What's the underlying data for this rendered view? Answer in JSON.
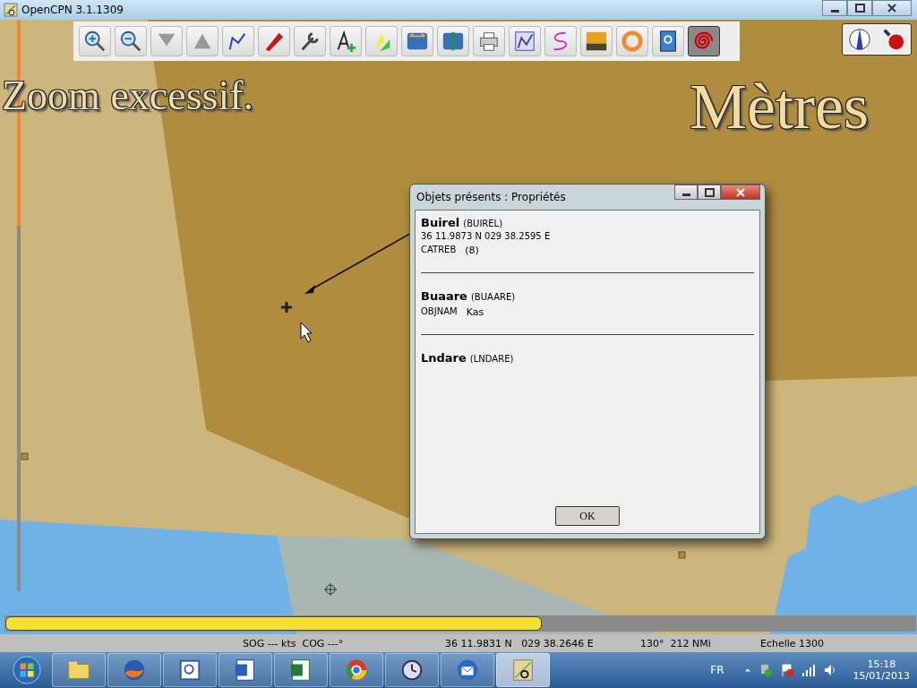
{
  "window": {
    "title": "OpenCPN 3.1.1309"
  },
  "toolbar": [
    {
      "kind": "zoom-in",
      "selected": false
    },
    {
      "kind": "zoom-out",
      "selected": false
    },
    {
      "kind": "funnel",
      "selected": false
    },
    {
      "kind": "cone",
      "selected": false
    },
    {
      "kind": "route",
      "selected": false
    },
    {
      "kind": "boat",
      "selected": false
    },
    {
      "kind": "wrench",
      "selected": false
    },
    {
      "kind": "text-add",
      "selected": false
    },
    {
      "kind": "flags",
      "selected": false
    },
    {
      "kind": "width",
      "selected": false
    },
    {
      "kind": "height",
      "selected": false
    },
    {
      "kind": "printer",
      "selected": false
    },
    {
      "kind": "chart-edit",
      "selected": false
    },
    {
      "kind": "track",
      "selected": false
    },
    {
      "kind": "sunset",
      "selected": false
    },
    {
      "kind": "ring",
      "selected": false
    },
    {
      "kind": "help-book",
      "selected": false
    },
    {
      "kind": "spiral",
      "selected": true
    }
  ],
  "map": {
    "zoom_warning": "Zoom excessif.",
    "units_label": "Mètres",
    "quilt_bar": {
      "level": 0.59
    }
  },
  "dialog": {
    "title": "Objets présents : Propriétés",
    "objects": [
      {
        "name": "Buirel",
        "code": "(BUIREL)",
        "position": "36 11.9873 N 029 38.2595 E",
        "attributes": [
          {
            "label": "CATREB",
            "value": "(8)"
          }
        ]
      },
      {
        "name": "Buaare",
        "code": "(BUAARE)",
        "attributes": [
          {
            "label": "OBJNAM",
            "value": "Kas"
          }
        ]
      },
      {
        "name": "Lndare",
        "code": "(LNDARE)"
      }
    ],
    "ok_button": "OK"
  },
  "status_bar": [
    "SOG --- kts  COG ---°",
    "36 11.9831 N   029 38.2646 E",
    "130°  212 NMi",
    "Echelle 1300"
  ],
  "taskbar": {
    "apps": [
      {
        "kind": "folder",
        "selected": false
      },
      {
        "kind": "globe",
        "selected": false
      },
      {
        "kind": "presentation",
        "selected": false
      },
      {
        "kind": "document",
        "selected": false
      },
      {
        "kind": "spreadsheet",
        "selected": false
      },
      {
        "kind": "wheel",
        "selected": false
      },
      {
        "kind": "clock",
        "selected": false
      },
      {
        "kind": "envelope",
        "selected": false
      },
      {
        "kind": "chart",
        "selected": true
      }
    ],
    "language": "FR",
    "time": "15:18",
    "date": "15/01/2013"
  }
}
